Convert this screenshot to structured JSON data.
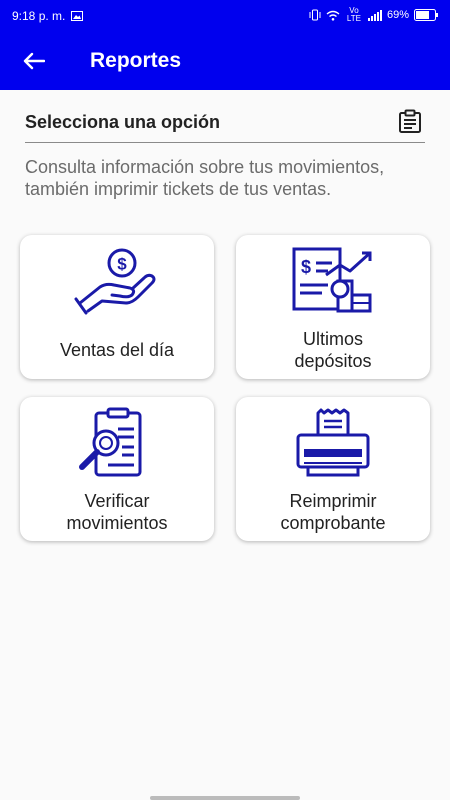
{
  "status_bar": {
    "time": "9:18 p. m.",
    "network": "Vo LTE",
    "battery": "69%"
  },
  "app_bar": {
    "title": "Reportes"
  },
  "section": {
    "title": "Selecciona una opción",
    "description": "Consulta información sobre tus movimientos, también imprimir tickets de tus ventas."
  },
  "options": [
    {
      "label_line1": "Ventas del día",
      "label_line2": "",
      "icon": "hand-money-icon"
    },
    {
      "label_line1": "Ultimos",
      "label_line2": "depósitos",
      "icon": "deposits-chart-icon"
    },
    {
      "label_line1": "Verificar",
      "label_line2": "movimientos",
      "icon": "verify-document-icon"
    },
    {
      "label_line1": "Reimprimir",
      "label_line2": "comprobante",
      "icon": "printer-icon"
    }
  ],
  "colors": {
    "primary": "#0000ee",
    "icon_stroke": "#1a1aa8"
  }
}
